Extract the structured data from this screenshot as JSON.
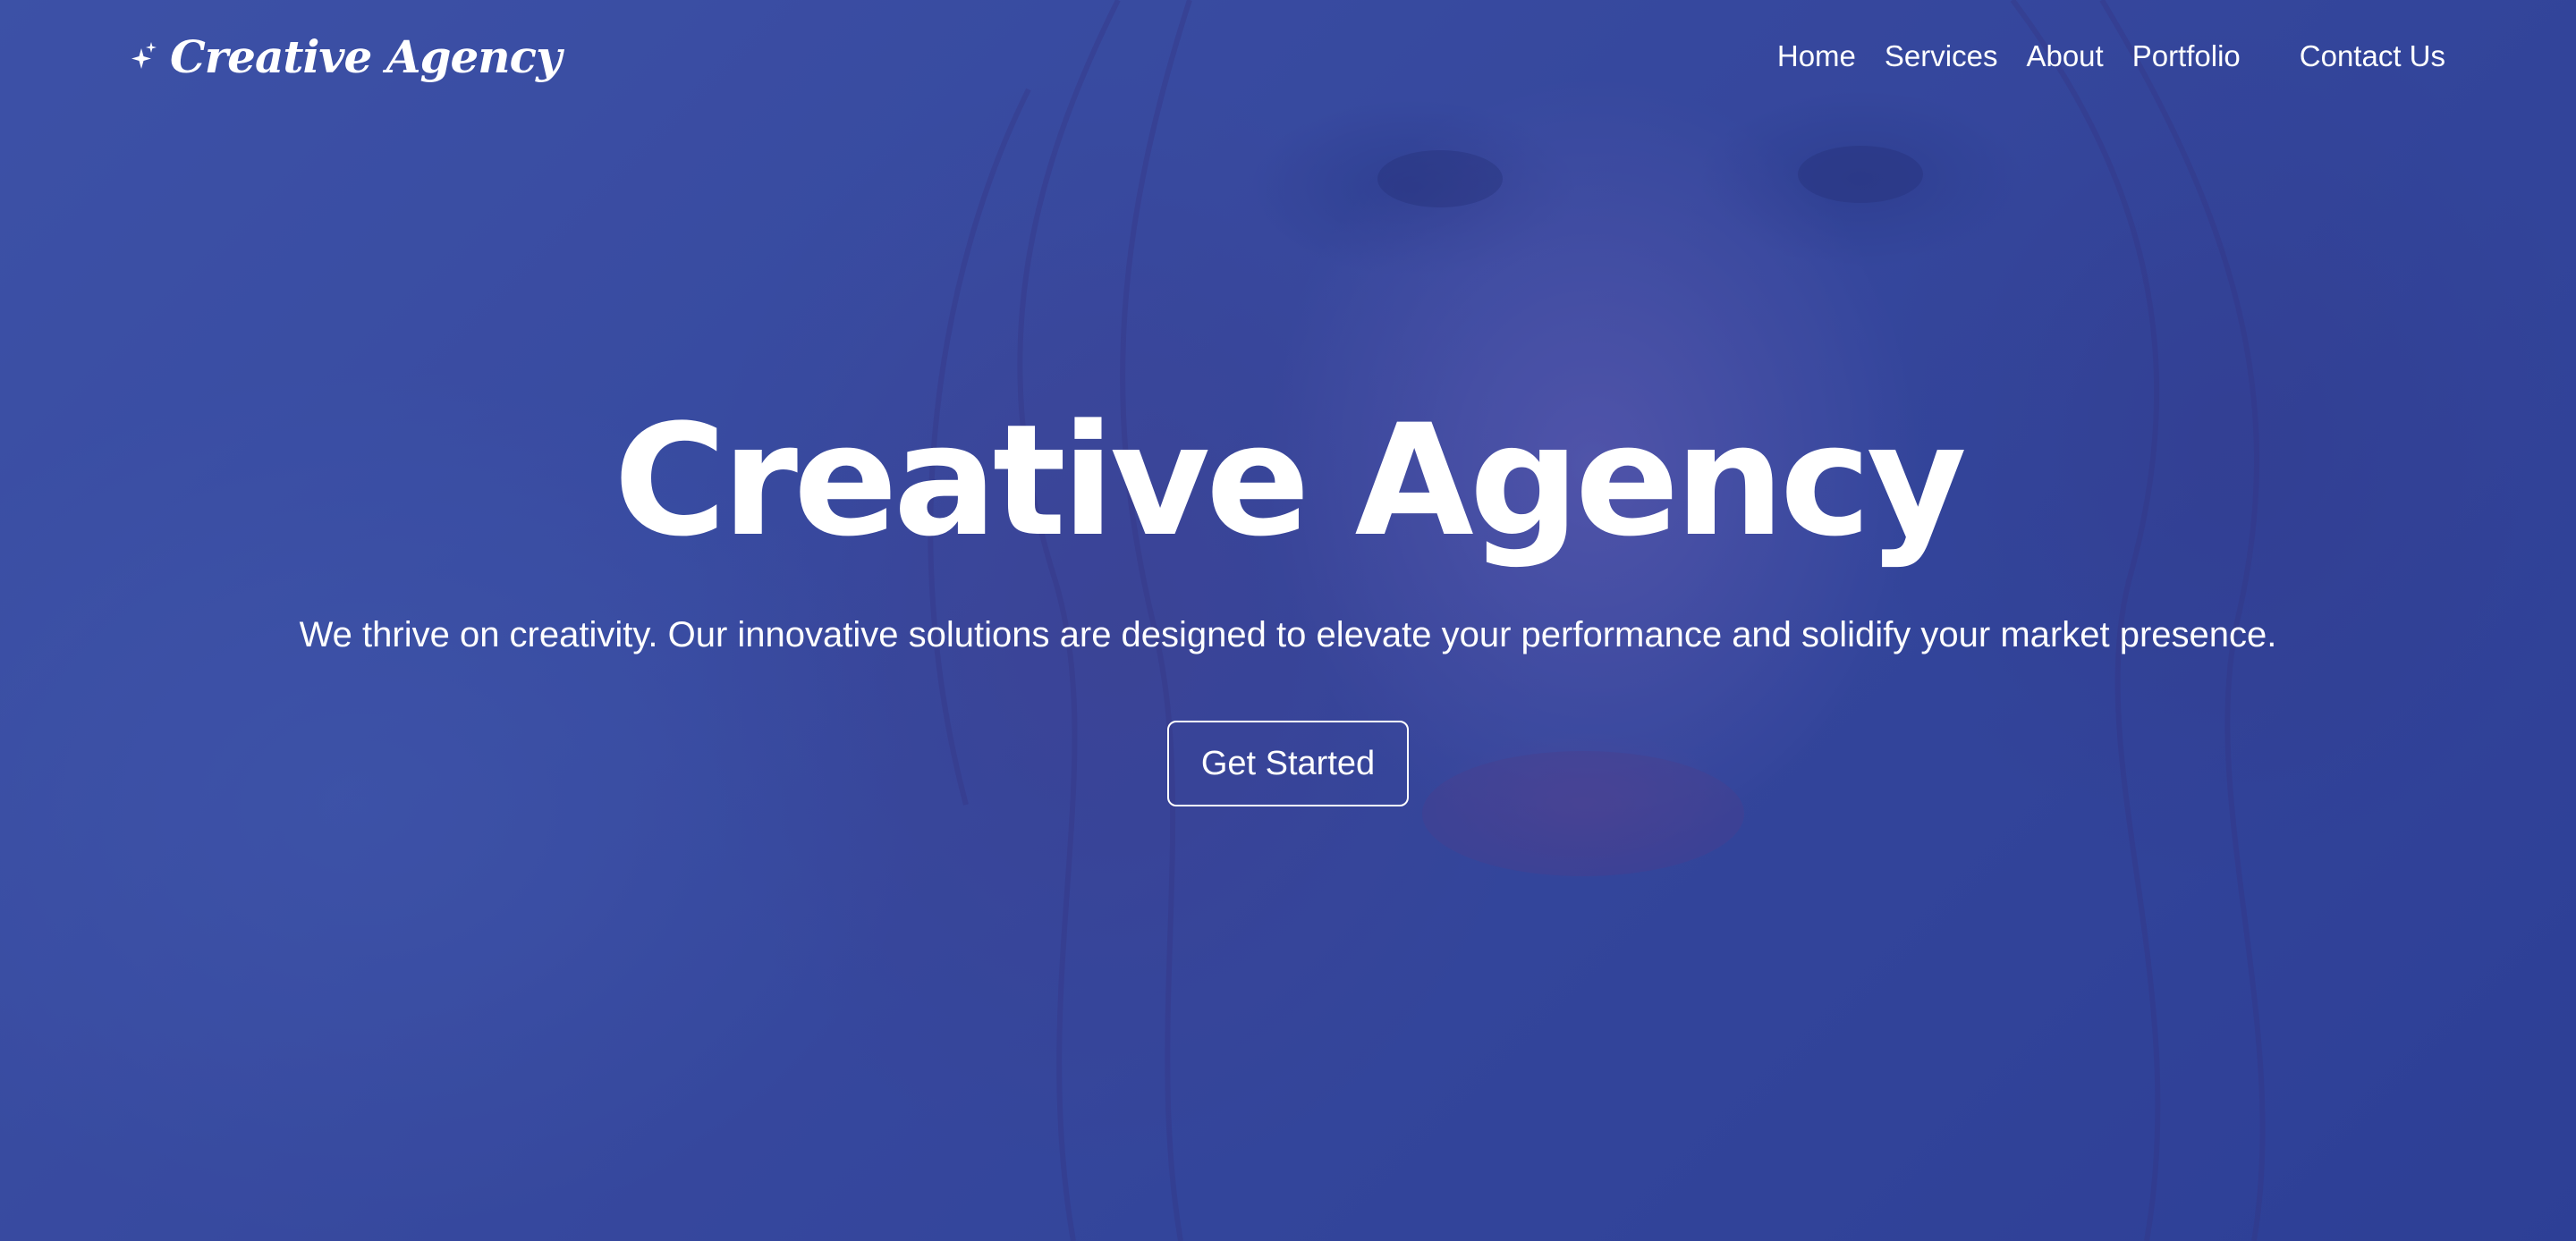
{
  "navbar": {
    "brand": {
      "icon": "sparkles-icon",
      "name": "Creative Agency"
    },
    "links": [
      {
        "label": "Home"
      },
      {
        "label": "Services"
      },
      {
        "label": "About"
      },
      {
        "label": "Portfolio"
      },
      {
        "label": "Contact Us"
      }
    ]
  },
  "hero": {
    "title": "Creative Agency",
    "subtitle": "We thrive on creativity. Our innovative solutions are designed to elevate your performance and solidify your market presence.",
    "cta_label": "Get Started"
  },
  "colors": {
    "overlay": "#2d419b",
    "text": "#ffffff"
  }
}
